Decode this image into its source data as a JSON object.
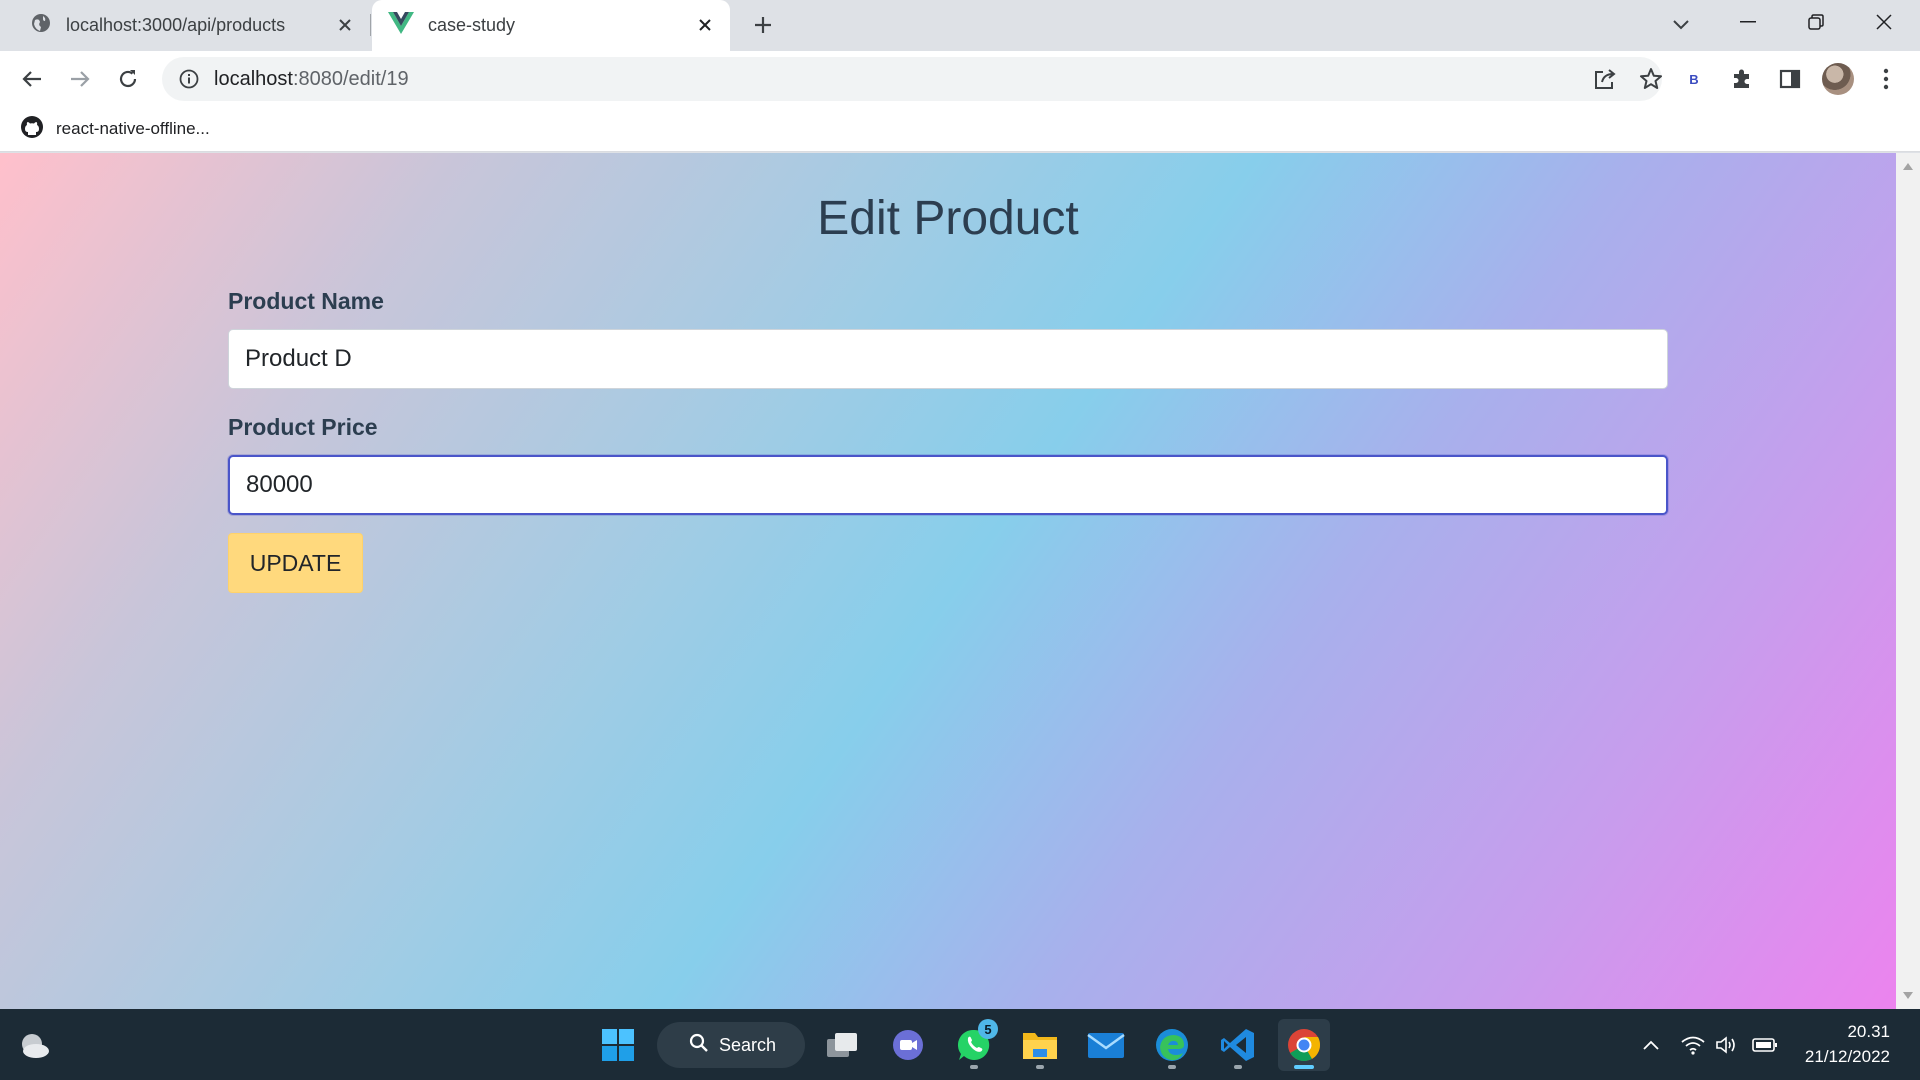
{
  "browser": {
    "tabs": [
      {
        "title": "localhost:3000/api/products",
        "active": false,
        "icon": "globe-icon"
      },
      {
        "title": "case-study",
        "active": true,
        "icon": "vue-logo-icon"
      }
    ],
    "url_host": "localhost",
    "url_path": ":8080/edit/19",
    "extension_letter": "B",
    "bookmarks": [
      {
        "label": "react-native-offline...",
        "icon": "github-icon"
      }
    ]
  },
  "page": {
    "title": "Edit Product",
    "name_label": "Product Name",
    "name_value": "Product D",
    "price_label": "Product Price",
    "price_value": "80000",
    "update_label": "UPDATE"
  },
  "taskbar": {
    "search_label": "Search",
    "whatsapp_badge": "5",
    "time": "20.31",
    "date": "21/12/2022"
  },
  "colors": {
    "heading": "#2c3e50",
    "button": "#ffd97d",
    "gradient": [
      "#ffc0cb",
      "#87ceeb",
      "#ee82ee"
    ],
    "taskbar": "#1c2b36"
  }
}
